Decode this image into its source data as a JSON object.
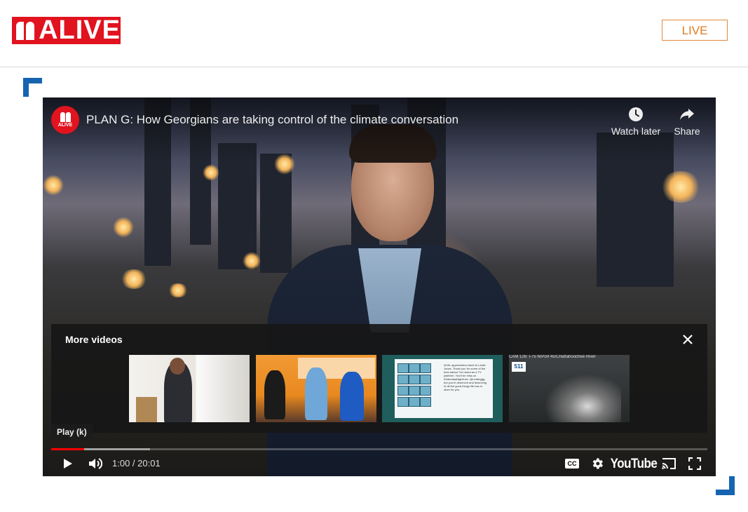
{
  "header": {
    "logo_text": "ALIVE",
    "live_label": "LIVE"
  },
  "player": {
    "channel_logo_text": "ALIVE",
    "title": "PLAN G: How Georgians are taking control of the climate conversation",
    "watch_later_label": "Watch later",
    "share_label": "Share",
    "more_videos": {
      "title": "More videos",
      "thumbnail_3_text": "#OAL appreciation tweet to Leslie Jones. Thank you for some of the best advice I've heard as a TV platform. You'll be miss on #SaturdayNightLive. @Leslieggg, but you're deserved and deserving of all the good things life has in store for you.",
      "thumbnail_4_label": "CAM 126: I-75 N/Port 45/Chattahoochee River"
    },
    "tooltip": "Play (k)",
    "time": {
      "current": "1:00",
      "separator": " / ",
      "duration": "20:01"
    },
    "progress": {
      "played_fraction": 0.05,
      "buffered_fraction": 0.151
    },
    "youtube_label": "YouTube",
    "cc_label": "CC"
  },
  "colors": {
    "brand_red": "#e1131f",
    "live_orange": "#e07a20",
    "corner_blue": "#1664b1",
    "progress_red": "#ff0000"
  },
  "icons": [
    "play-icon",
    "volume-icon",
    "cc-icon",
    "settings-icon",
    "cast-icon",
    "fullscreen-icon",
    "clock-icon",
    "share-icon",
    "close-icon"
  ]
}
